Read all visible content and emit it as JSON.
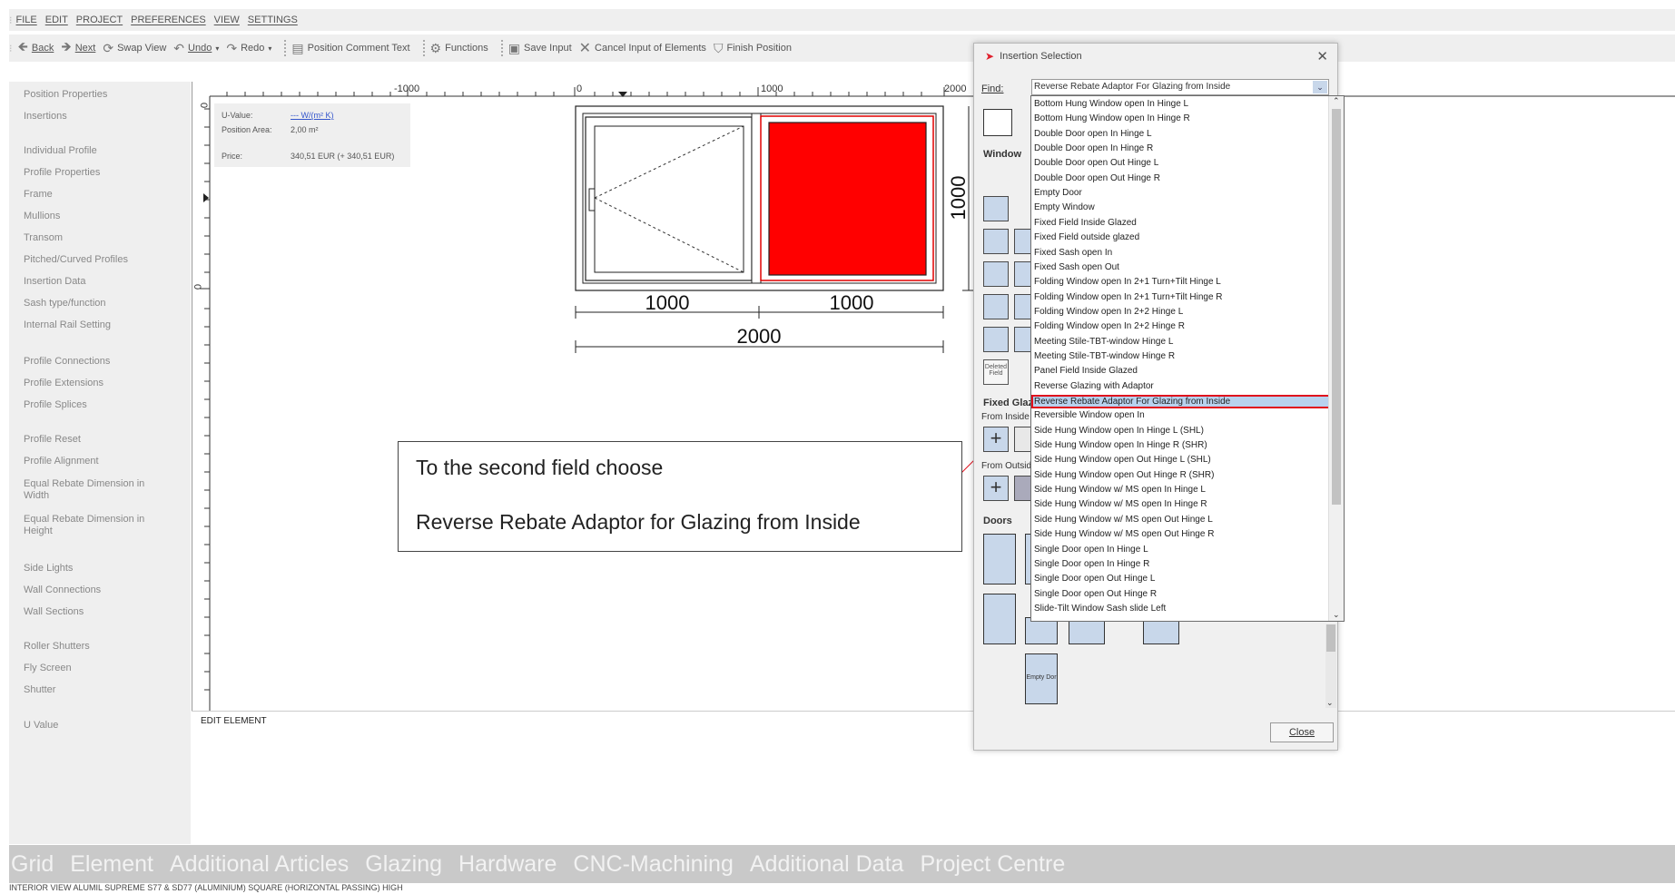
{
  "menu": [
    "FILE",
    "EDIT",
    "PROJECT",
    "PREFERENCES",
    "VIEW",
    "SETTINGS"
  ],
  "toolbar": {
    "back": "Back",
    "next": "Next",
    "swap_view": "Swap View",
    "undo": "Undo",
    "redo": "Redo",
    "position_comment": "Position Comment Text",
    "functions": "Functions",
    "save_input": "Save Input",
    "cancel_input": "Cancel Input of Elements",
    "finish_position": "Finish Position"
  },
  "left_panel": [
    "Position Properties",
    "Insertions",
    "Individual Profile",
    "Profile Properties",
    "Frame",
    "Mullions",
    "Transom",
    "Pitched/Curved Profiles",
    "Insertion Data",
    "Sash type/function",
    "Internal Rail Setting",
    "Profile Connections",
    "Profile Extensions",
    "Profile Splices",
    "Profile Reset",
    "Profile Alignment",
    "Equal Rebate Dimension in Width",
    "Equal Rebate Dimension in Height",
    "Side Lights",
    "Wall Connections",
    "Wall Sections",
    "Roller Shutters",
    "Fly Screen",
    "Shutter",
    "U Value"
  ],
  "info": {
    "u_value_label": "U-Value:",
    "u_value": "--- W/(m² K)",
    "area_label": "Position Area:",
    "area": "2,00 m²",
    "price_label": "Price:",
    "price": "340,51 EUR (+ 340,51 EUR)"
  },
  "ruler": {
    "top_ticks": [
      "-1000",
      "0",
      "1000",
      "2000"
    ],
    "left_ticks": [
      "0",
      "0"
    ]
  },
  "drawing": {
    "dim_left": "1000",
    "dim_right": "1000",
    "dim_total": "2000",
    "dim_height": "1000"
  },
  "edit_panel": {
    "title": "EDIT ELEMENT"
  },
  "callout": {
    "line1": "To the second field choose",
    "line2": "Reverse Rebate Adaptor for Glazing from Inside"
  },
  "dialog": {
    "title": "Insertion Selection",
    "find_label": "Find:",
    "find_value": "Reverse Rebate Adaptor For Glazing from Inside",
    "window_heading": "Window",
    "fixed_heading": "Fixed Glaz",
    "from_inside": "From Inside",
    "from_outside": "From Outsid",
    "doors_heading": "Doors",
    "deleted_field": "Deleted Field",
    "empty_door": "Empty Dor",
    "close": "Close",
    "options": [
      "Bottom Hung Window open In  Hinge L",
      "Bottom Hung Window open In  Hinge R",
      "Double Door open In  Hinge L",
      "Double Door open In  Hinge R",
      "Double Door open Out  Hinge L",
      "Double Door open Out  Hinge R",
      "Empty Door",
      "Empty Window",
      "Fixed Field Inside Glazed",
      "Fixed Field outside glazed",
      "Fixed Sash open In",
      "Fixed Sash open Out",
      "Folding Window open In 2+1 Turn+Tilt  Hinge L",
      "Folding Window open In 2+1 Turn+Tilt  Hinge R",
      "Folding Window open In 2+2  Hinge L",
      "Folding Window open In 2+2  Hinge R",
      "Meeting Stile-TBT-window  Hinge L",
      "Meeting Stile-TBT-window  Hinge R",
      "Panel Field Inside Glazed",
      "Reverse Glazing with Adaptor",
      "Reverse Rebate Adaptor For Glazing from Inside",
      "Reversible Window open In",
      "Side Hung Window open In  Hinge L (SHL)",
      "Side Hung Window open In  Hinge R (SHR)",
      "Side Hung Window open Out  Hinge L (SHL)",
      "Side Hung Window open Out  Hinge R (SHR)",
      "Side Hung Window w/ MS open In  Hinge L",
      "Side Hung Window w/ MS open In  Hinge R",
      "Side Hung Window w/ MS open Out  Hinge L",
      "Side Hung Window w/ MS open Out  Hinge R",
      "Single Door open In  Hinge L",
      "Single Door open In  Hinge R",
      "Single Door open Out  Hinge L",
      "Single Door open Out  Hinge R",
      "Slide-Tilt Window  Sash slide Left"
    ],
    "selected_index": 20
  },
  "bottom_tabs": [
    "Grid",
    "Element",
    "Additional Articles",
    "Glazing",
    "Hardware",
    "CNC-Machining",
    "Additional Data",
    "Project Centre"
  ],
  "status": "INTERIOR VIEW   ALUMIL SUPREME S77 & SD77 (ALUMINIUM) SQUARE (HORIZONTAL PASSING) HIGH",
  "colors": {
    "accent_red": "#ff0000",
    "highlight_border": "#e0101d",
    "selection_bg": "#b8d2ee"
  }
}
